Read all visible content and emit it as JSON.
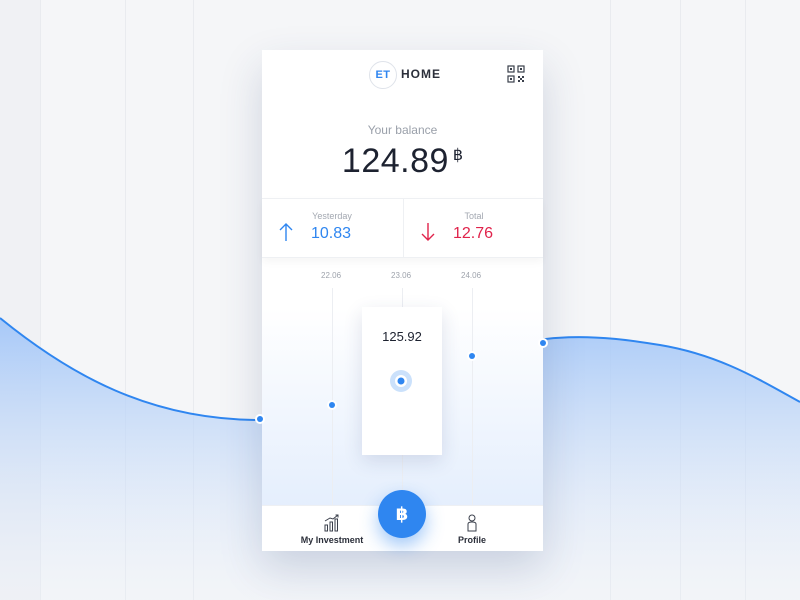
{
  "header": {
    "logo_text": "ET",
    "title": "HOME",
    "qr_icon": "qr-code-icon"
  },
  "balance": {
    "label": "Your balance",
    "value": "124.89",
    "currency_symbol": "฿"
  },
  "stats": {
    "yesterday": {
      "label": "Yesterday",
      "value": "10.83",
      "direction": "up",
      "color": "#2f86f0"
    },
    "total": {
      "label": "Total",
      "value": "12.76",
      "direction": "down",
      "color": "#e0234b"
    }
  },
  "chart": {
    "dates": [
      "22.06",
      "23.06",
      "24.06"
    ],
    "tooltip_value": "125.92",
    "accent": "#2f86f0"
  },
  "bottom_nav": {
    "investment_label": "My Investment",
    "profile_label": "Profile",
    "fab_symbol": "฿",
    "fab_color": "#2f86f0"
  }
}
